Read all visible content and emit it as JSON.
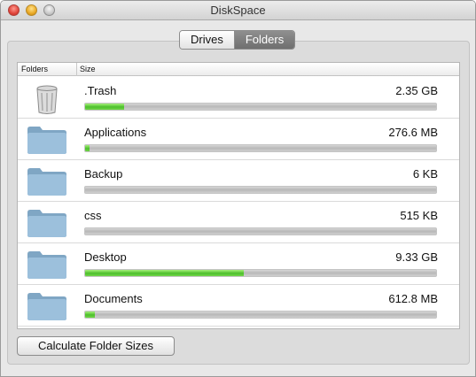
{
  "window": {
    "title": "DiskSpace"
  },
  "tabs": [
    {
      "label": "Drives",
      "active": false
    },
    {
      "label": "Folders",
      "active": true
    }
  ],
  "list": {
    "columns": [
      "Folders",
      "Size"
    ],
    "rows": [
      {
        "icon": "trash-icon",
        "name": ".Trash",
        "size": "2.35 GB",
        "fraction": 0.11
      },
      {
        "icon": "folder-icon",
        "name": "Applications",
        "size": "276.6 MB",
        "fraction": 0.012
      },
      {
        "icon": "folder-icon",
        "name": "Backup",
        "size": "6 KB",
        "fraction": 0
      },
      {
        "icon": "folder-icon",
        "name": "css",
        "size": "515 KB",
        "fraction": 0
      },
      {
        "icon": "folder-icon",
        "name": "Desktop",
        "size": "9.33 GB",
        "fraction": 0.45
      },
      {
        "icon": "folder-icon",
        "name": "Documents",
        "size": "612.8 MB",
        "fraction": 0.028
      }
    ]
  },
  "actions": {
    "calculate_label": "Calculate Folder Sizes"
  },
  "colors": {
    "bar_fill": "#4cbf2c",
    "folder": "#8fb4d0"
  }
}
